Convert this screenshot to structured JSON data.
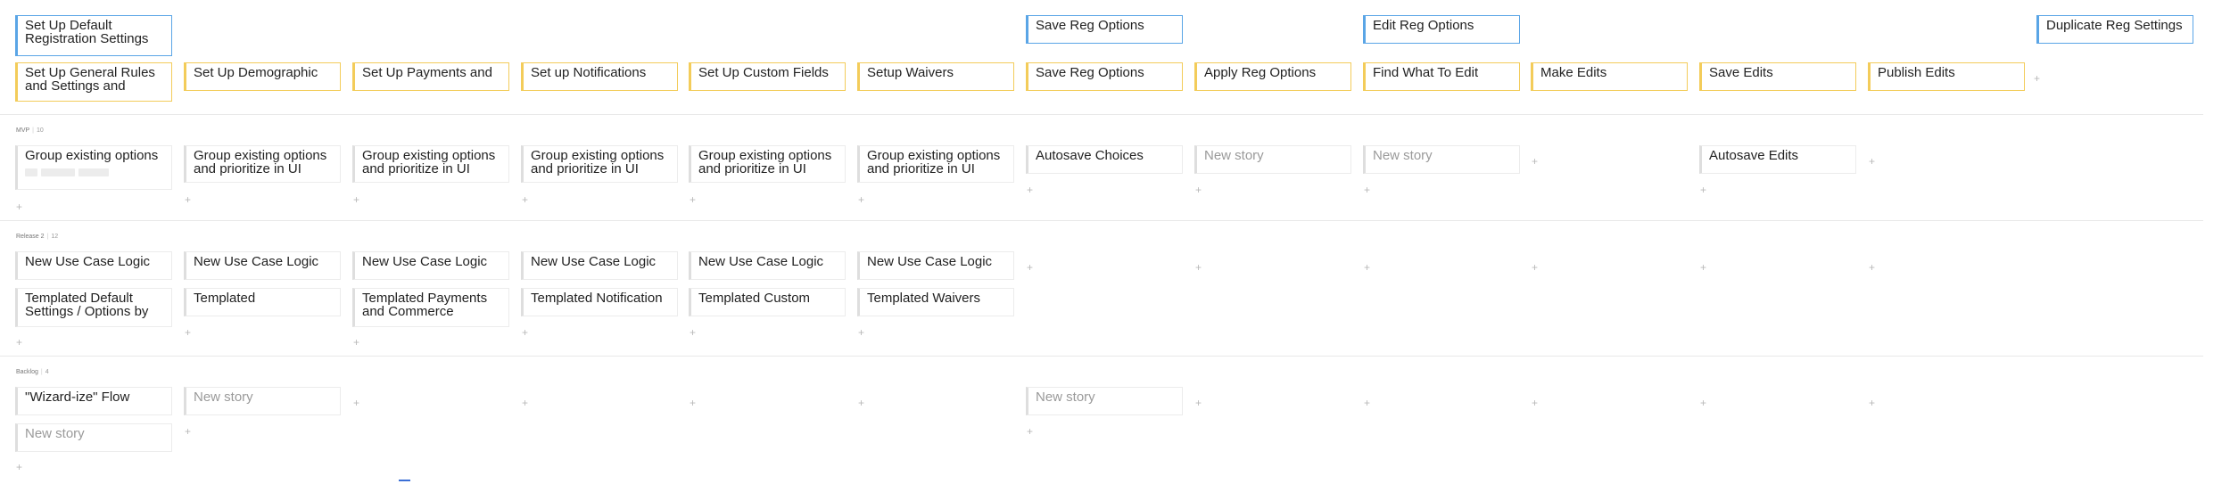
{
  "activities": [
    "Set Up Default Registration Settings",
    "Save Reg Options",
    "Edit Reg Options",
    "Duplicate Reg Settings"
  ],
  "steps": [
    "Set Up General Rules and Settings and",
    "Set Up Demographic",
    "Set Up Payments and",
    "Set up Notifications",
    "Set Up Custom Fields",
    "Setup Waivers",
    "Save Reg Options",
    "Apply Reg Options",
    "Find What To Edit",
    "Make Edits",
    "Save Edits",
    "Publish Edits"
  ],
  "releases": [
    {
      "name": "MVP",
      "count": "10",
      "stories": [
        "Group existing options",
        "Group existing options and prioritize in UI",
        "Group existing options and prioritize in UI",
        "Group existing options and prioritize in UI",
        "Group existing options and prioritize in UI",
        "Group existing options and prioritize in UI",
        "Autosave Choices",
        "New story",
        "New story",
        "Autosave Edits"
      ]
    },
    {
      "name": "Release 2",
      "count": "12",
      "stories": [
        "New Use Case Logic",
        "New Use Case Logic",
        "New Use Case Logic",
        "New Use Case Logic",
        "New Use Case Logic",
        "New Use Case Logic",
        "Templated Default Settings / Options by",
        "Templated",
        "Templated Payments and Commerce",
        "Templated Notification",
        "Templated Custom",
        "Templated Waivers"
      ]
    },
    {
      "name": "Backlog",
      "count": "4",
      "stories": [
        "\"Wizard-ize\" Flow",
        "New story",
        "New story",
        "New story"
      ]
    }
  ],
  "add_symbol": "+"
}
